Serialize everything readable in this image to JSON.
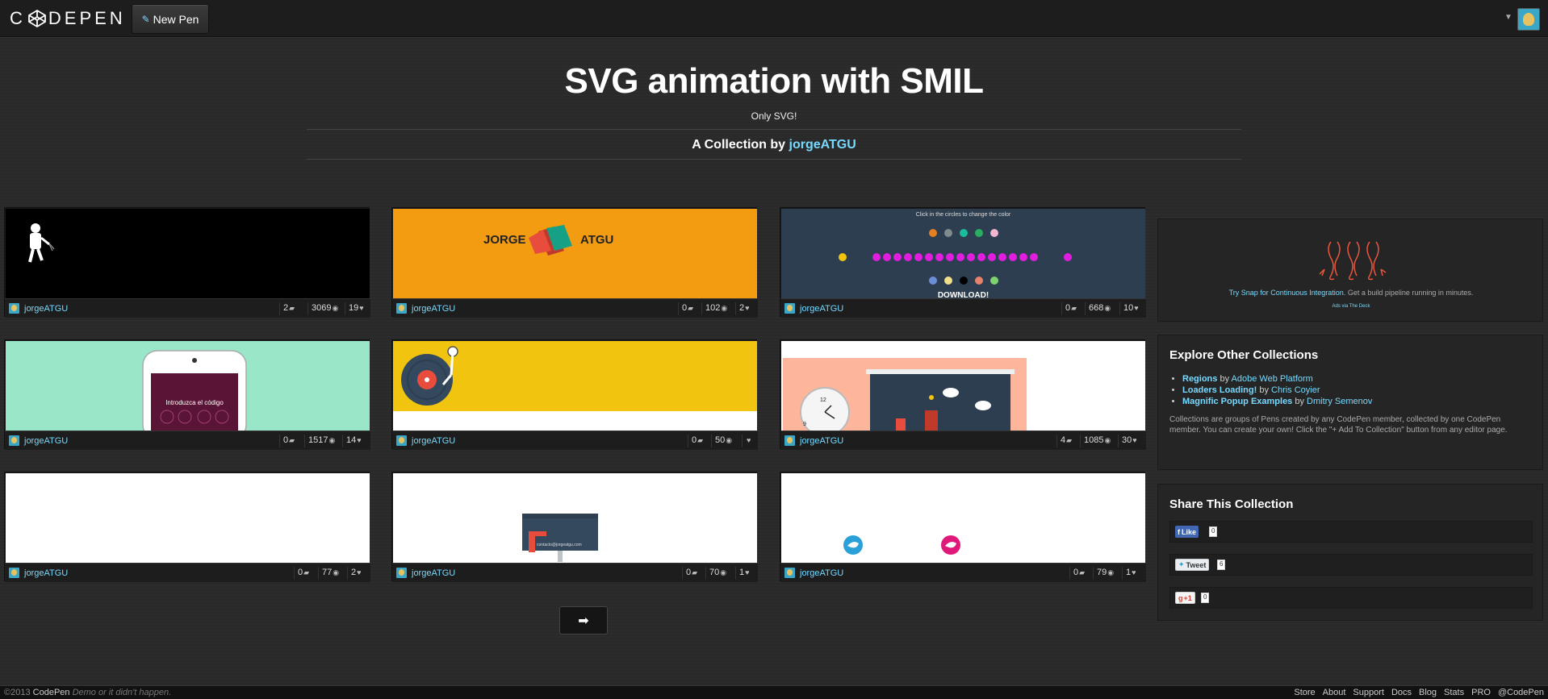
{
  "header": {
    "logo_text": "C DEPEN",
    "new_pen_label": "New Pen"
  },
  "collection": {
    "title": "SVG animation with SMIL",
    "description": "Only SVG!",
    "by_prefix": "A Collection by ",
    "by_user": "jorgeATGU"
  },
  "pens": [
    {
      "author": "jorgeATGU",
      "comments": "2",
      "views": "3069",
      "hearts": "19"
    },
    {
      "author": "jorgeATGU",
      "comments": "0",
      "views": "102",
      "hearts": "2"
    },
    {
      "author": "jorgeATGU",
      "comments": "0",
      "views": "668",
      "hearts": "10"
    },
    {
      "author": "jorgeATGU",
      "comments": "0",
      "views": "1517",
      "hearts": "14"
    },
    {
      "author": "jorgeATGU",
      "comments": "0",
      "views": "50",
      "hearts": ""
    },
    {
      "author": "jorgeATGU",
      "comments": "4",
      "views": "1085",
      "hearts": "30"
    },
    {
      "author": "jorgeATGU",
      "comments": "0",
      "views": "77",
      "hearts": "2"
    },
    {
      "author": "jorgeATGU",
      "comments": "0",
      "views": "70",
      "hearts": "1"
    },
    {
      "author": "jorgeATGU",
      "comments": "0",
      "views": "79",
      "hearts": "1"
    }
  ],
  "thumbs": {
    "jorge_left": "JORGE",
    "jorge_right": "ATGU",
    "color_hint": "Click in the circles to change the color",
    "download": "DOWNLOAD!",
    "phone_text": "Introduzca el código",
    "clock_12": "12",
    "clock_9": "9",
    "sign_text": "contacto@jorgeatgu.com"
  },
  "ad": {
    "link_text": "Try Snap for Continuous Integration.",
    "rest_text": " Get a build pipeline running in minutes.",
    "via": "Ads via The Deck"
  },
  "explore": {
    "heading": "Explore Other Collections",
    "items": [
      {
        "title": "Regions",
        "by": " by ",
        "author": "Adobe Web Platform"
      },
      {
        "title": "Loaders Loading!",
        "by": " by ",
        "author": "Chris Coyier"
      },
      {
        "title": "Magnific Popup Examples",
        "by": " by ",
        "author": "Dmitry Semenov"
      }
    ],
    "paragraph": "Collections are groups of Pens created by any CodePen member, collected by one CodePen member. You can create your own! Click the \"+ Add To Collection\" button from any editor page."
  },
  "share": {
    "heading": "Share This Collection",
    "facebook_label": "Like",
    "facebook_count": "0",
    "twitter_label": "Tweet",
    "twitter_count": "6",
    "gplus_label": "+1",
    "gplus_count": "0"
  },
  "footer": {
    "copyright": "©2013 ",
    "brand": "CodePen",
    "tagline": " Demo or it didn't happen.",
    "links": [
      "Store",
      "About",
      "Support",
      "Docs",
      "Blog",
      "Stats",
      "PRO",
      "@CodePen"
    ]
  },
  "colors": {
    "link": "#76daff",
    "orange_thumb": "#f39c12",
    "navy_thumb": "#2d3e50",
    "mint_thumb": "#99e6c8",
    "yellow_thumb": "#f1c40f",
    "salmon_thumb": "#fdb59b"
  },
  "icons": {
    "comments": "comment-icon",
    "views": "eye-icon",
    "hearts": "heart-icon",
    "next": "arrow-right-icon"
  }
}
